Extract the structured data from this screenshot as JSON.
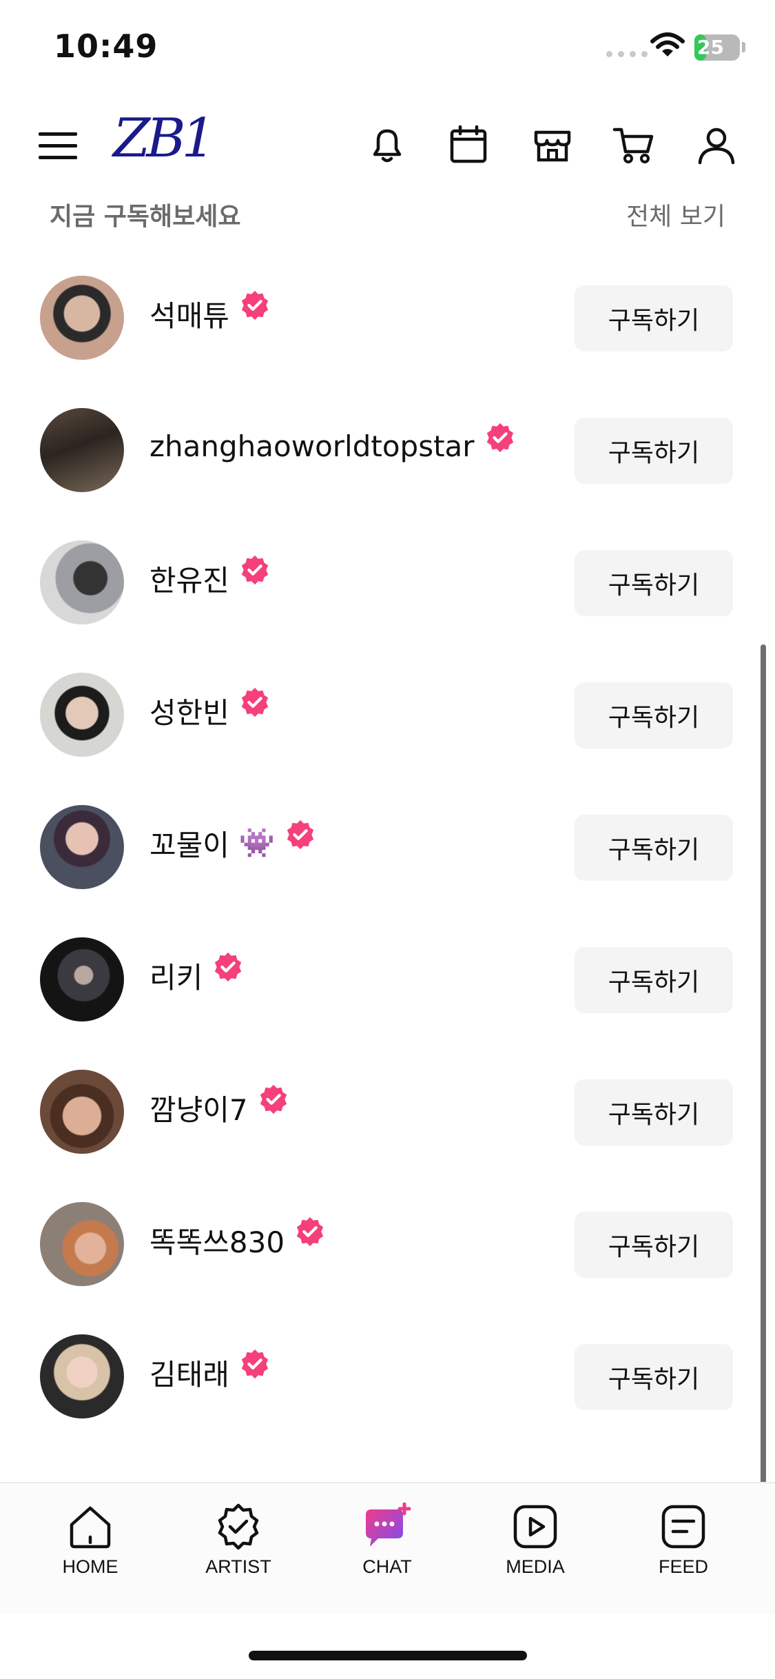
{
  "status": {
    "time": "10:49",
    "battery": "25",
    "battery_level": 0.25
  },
  "header": {
    "logo": "ZB1",
    "icons": [
      "menu-icon",
      "bell-icon",
      "calendar-icon",
      "shop-icon",
      "cart-icon",
      "profile-icon"
    ]
  },
  "section": {
    "title": "지금 구독해보세요",
    "see_all": "전체 보기"
  },
  "subscribe_label": "구독하기",
  "artists": [
    {
      "name": "석매튜",
      "emoji": ""
    },
    {
      "name": "zhanghaoworldtopstar",
      "emoji": ""
    },
    {
      "name": "한유진",
      "emoji": ""
    },
    {
      "name": "성한빈",
      "emoji": ""
    },
    {
      "name": "꼬물이",
      "emoji": "👾"
    },
    {
      "name": "리키",
      "emoji": ""
    },
    {
      "name": "깜냥이7",
      "emoji": ""
    },
    {
      "name": "똑똑쓰830",
      "emoji": ""
    },
    {
      "name": "김태래",
      "emoji": ""
    }
  ],
  "colors": {
    "accent": "#f5407a",
    "logo": "#1a1a8c",
    "button_bg": "#f4f4f4"
  },
  "tabs": [
    {
      "label": "HOME",
      "icon": "home-icon"
    },
    {
      "label": "ARTIST",
      "icon": "artist-badge-icon"
    },
    {
      "label": "CHAT",
      "icon": "chat-icon"
    },
    {
      "label": "MEDIA",
      "icon": "play-icon"
    },
    {
      "label": "FEED",
      "icon": "feed-icon"
    }
  ]
}
